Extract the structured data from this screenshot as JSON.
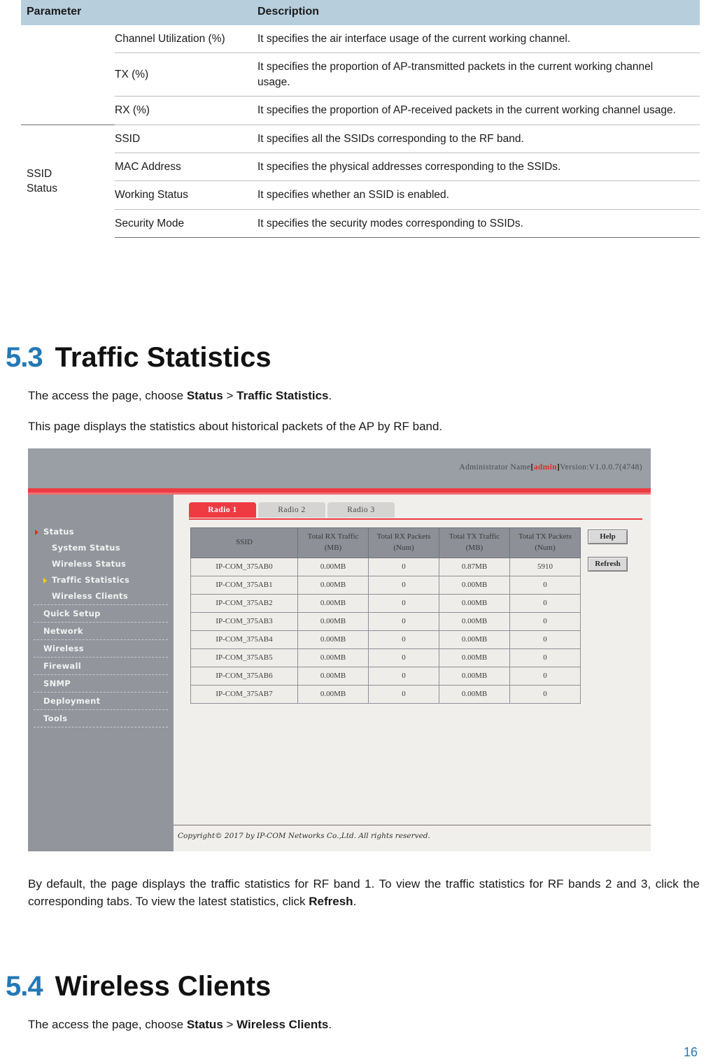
{
  "param_table": {
    "headers": {
      "parameter": "Parameter",
      "description": "Description"
    },
    "groups": [
      {
        "name": "",
        "rows": [
          {
            "sub": "Channel Utilization (%)",
            "desc": "It specifies the air interface usage of the current working channel."
          },
          {
            "sub": "TX (%)",
            "desc": "It specifies the proportion of AP-transmitted packets in the current working channel usage."
          },
          {
            "sub": "RX (%)",
            "desc": "It specifies the proportion of AP-received packets in the current working channel usage."
          }
        ]
      },
      {
        "name": "SSID\nStatus",
        "rows": [
          {
            "sub": "SSID",
            "desc": "It specifies all the SSIDs corresponding to the RF band."
          },
          {
            "sub": "MAC Address",
            "desc": "It specifies the physical addresses corresponding to the SSIDs."
          },
          {
            "sub": "Working Status",
            "desc": "It specifies whether an SSID is enabled."
          },
          {
            "sub": "Security Mode",
            "desc": "It specifies the security modes corresponding to SSIDs."
          }
        ]
      }
    ]
  },
  "section_53": {
    "number": "5.3",
    "title": "Traffic Statistics",
    "intro_prefix": "The access the page, choose ",
    "intro_bold1": "Status",
    "intro_sep": " > ",
    "intro_bold2": "Traffic Statistics",
    "intro_suffix": ".",
    "description": "This page displays the statistics about historical packets of the AP by RF band.",
    "note_part1": "By default, the page displays the traffic statistics for RF band 1. To view the traffic statistics for RF bands 2 and 3, click the corresponding tabs. To view the latest statistics, click ",
    "note_bold": "Refresh",
    "note_part2": "."
  },
  "section_54": {
    "number": "5.4",
    "title": "Wireless Clients",
    "intro_prefix": "The access the page, choose ",
    "intro_bold1": "Status",
    "intro_sep": " > ",
    "intro_bold2": "Wireless Clients",
    "intro_suffix": "."
  },
  "screenshot": {
    "admin": {
      "label": "Administrator Name",
      "open_bracket": "[",
      "user": "admin",
      "close_bracket": "]",
      "version": "Version:V1.0.0.7(4748)"
    },
    "sidebar": {
      "items": [
        {
          "label": "Status",
          "level": "top",
          "arrow": "red-arrow-icon"
        },
        {
          "label": "System Status",
          "level": "sub",
          "arrow": ""
        },
        {
          "label": "Wireless Status",
          "level": "sub",
          "arrow": ""
        },
        {
          "label": "Traffic Statistics",
          "level": "sub",
          "arrow": "yellow-arrow-icon"
        },
        {
          "label": "Wireless Clients",
          "level": "sub",
          "arrow": ""
        },
        {
          "label": "Quick Setup",
          "level": "sep",
          "arrow": ""
        },
        {
          "label": "Network",
          "level": "sep",
          "arrow": ""
        },
        {
          "label": "Wireless",
          "level": "sep",
          "arrow": ""
        },
        {
          "label": "Firewall",
          "level": "sep",
          "arrow": ""
        },
        {
          "label": "SNMP",
          "level": "sep",
          "arrow": ""
        },
        {
          "label": "Deployment",
          "level": "sep",
          "arrow": ""
        },
        {
          "label": "Tools",
          "level": "sep",
          "arrow": ""
        }
      ]
    },
    "tabs": [
      {
        "label": "Radio 1",
        "active": true
      },
      {
        "label": "Radio 2",
        "active": false
      },
      {
        "label": "Radio 3",
        "active": false
      }
    ],
    "table": {
      "headers": [
        {
          "title": "SSID",
          "unit": ""
        },
        {
          "title": "Total RX Traffic",
          "unit": "(MB)"
        },
        {
          "title": "Total RX Packets",
          "unit": "(Num)"
        },
        {
          "title": "Total TX Traffic",
          "unit": "(MB)"
        },
        {
          "title": "Total TX Packets",
          "unit": "(Num)"
        }
      ],
      "rows": [
        [
          "IP-COM_375AB0",
          "0.00MB",
          "0",
          "0.87MB",
          "5910"
        ],
        [
          "IP-COM_375AB1",
          "0.00MB",
          "0",
          "0.00MB",
          "0"
        ],
        [
          "IP-COM_375AB2",
          "0.00MB",
          "0",
          "0.00MB",
          "0"
        ],
        [
          "IP-COM_375AB3",
          "0.00MB",
          "0",
          "0.00MB",
          "0"
        ],
        [
          "IP-COM_375AB4",
          "0.00MB",
          "0",
          "0.00MB",
          "0"
        ],
        [
          "IP-COM_375AB5",
          "0.00MB",
          "0",
          "0.00MB",
          "0"
        ],
        [
          "IP-COM_375AB6",
          "0.00MB",
          "0",
          "0.00MB",
          "0"
        ],
        [
          "IP-COM_375AB7",
          "0.00MB",
          "0",
          "0.00MB",
          "0"
        ]
      ]
    },
    "buttons": {
      "help": "Help",
      "refresh": "Refresh"
    },
    "copyright": "Copyright© 2017 by IP-COM Networks Co.,Ltd. All rights reserved."
  },
  "page_number": "16",
  "colors": {
    "accent_blue": "#2378b5",
    "table_header_blue": "#b7cedd",
    "brand_red": "#ee3a41",
    "sidebar_gray": "#92969c"
  }
}
